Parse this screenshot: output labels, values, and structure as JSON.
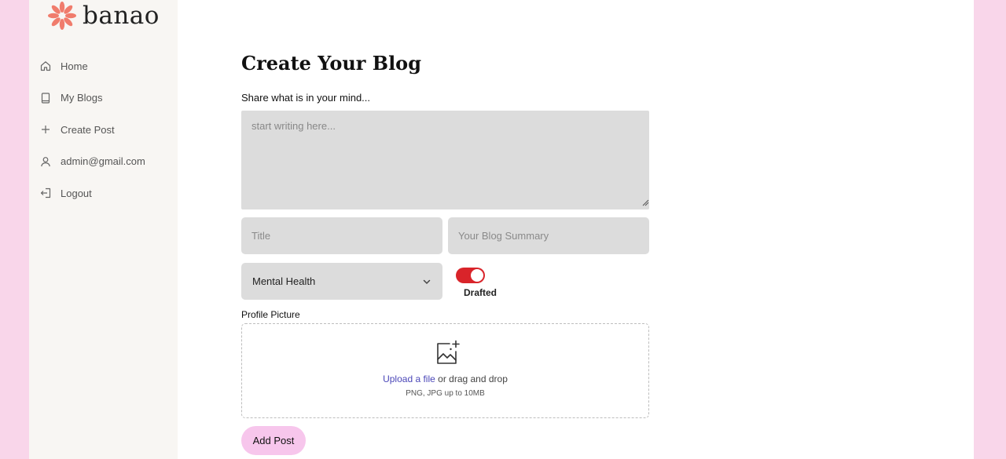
{
  "brand": {
    "name": "banao",
    "logo_color": "#f07c6c"
  },
  "sidebar": {
    "items": [
      {
        "label": "Home",
        "icon": "home-icon"
      },
      {
        "label": "My Blogs",
        "icon": "book-icon"
      },
      {
        "label": "Create Post",
        "icon": "plus-icon"
      },
      {
        "label": "admin@gmail.com",
        "icon": "user-icon"
      },
      {
        "label": "Logout",
        "icon": "logout-icon"
      }
    ]
  },
  "form": {
    "title": "Create Your Blog",
    "prompt_label": "Share what is in your mind...",
    "content_placeholder": "start writing here...",
    "title_placeholder": "Title",
    "summary_placeholder": "Your Blog Summary",
    "category_value": "Mental Health",
    "status_label": "Drafted",
    "status_toggle_color": "#d9242a",
    "upload_label": "Profile Picture",
    "upload_link": "Upload a file",
    "upload_text": "or drag and drop",
    "upload_hint": "PNG, JPG up to 10MB",
    "submit_label": "Add Post"
  },
  "colors": {
    "page_background": "#f9d6ea",
    "sidebar_background": "#f8f6f3",
    "field_background": "#dcdcdc",
    "button_background": "#f7c6ec",
    "link_color": "#4b47b8"
  }
}
